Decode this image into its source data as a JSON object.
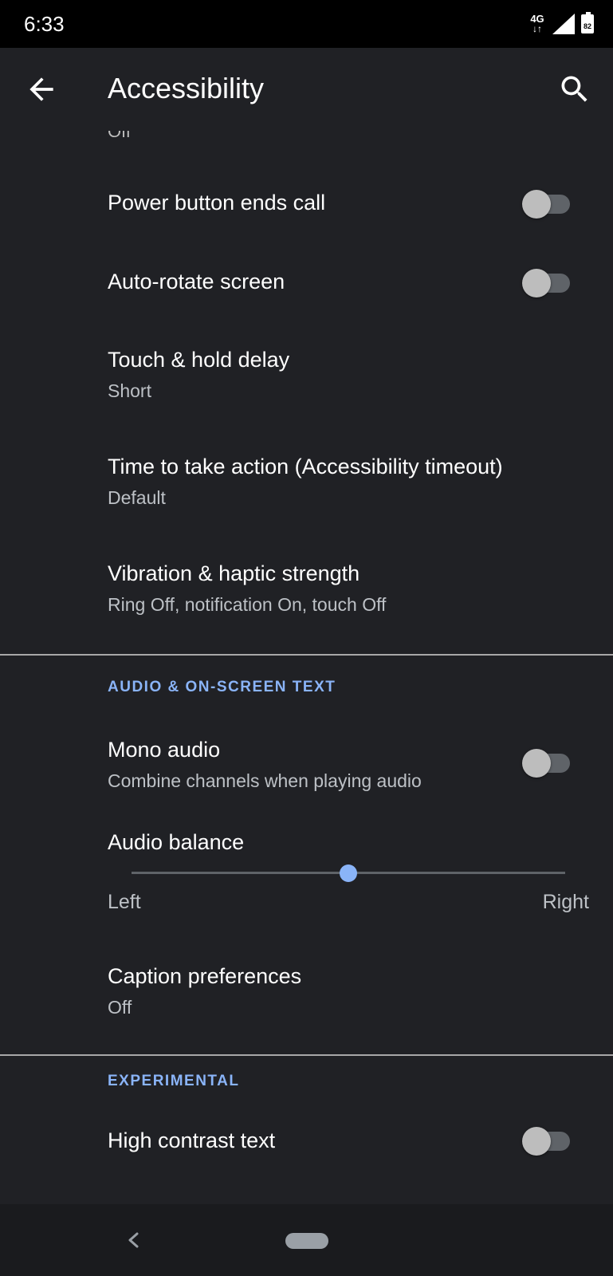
{
  "status_bar": {
    "time": "6:33",
    "network_type": "4G",
    "battery_level": "82",
    "icons": [
      "network-4g-icon",
      "signal-icon",
      "battery-icon"
    ]
  },
  "app_bar": {
    "title": "Accessibility",
    "back_icon": "arrow-back-icon",
    "search_icon": "search-icon"
  },
  "partial_top_summary": "Off",
  "items": [
    {
      "title": "Power button ends call",
      "toggle": false
    },
    {
      "title": "Auto-rotate screen",
      "toggle": false
    },
    {
      "title": "Touch & hold delay",
      "summary": "Short"
    },
    {
      "title": "Time to take action (Accessibility timeout)",
      "summary": "Default"
    },
    {
      "title": "Vibration & haptic strength",
      "summary": "Ring Off, notification On, touch Off"
    }
  ],
  "sections": {
    "audio": {
      "header": "AUDIO & ON-SCREEN TEXT",
      "mono_audio": {
        "title": "Mono audio",
        "summary": "Combine channels when playing audio",
        "toggle": false
      },
      "audio_balance": {
        "title": "Audio balance",
        "left_label": "Left",
        "right_label": "Right",
        "value": 0.5
      },
      "captions": {
        "title": "Caption preferences",
        "summary": "Off"
      }
    },
    "experimental": {
      "header": "EXPERIMENTAL",
      "high_contrast": {
        "title": "High contrast text",
        "toggle": false
      }
    }
  },
  "nav_bar": {
    "back_icon": "nav-back-icon",
    "home_icon": "home-pill-icon"
  },
  "colors": {
    "background": "#202125",
    "accent": "#8ab4f8",
    "toggle_off_thumb": "#bdbdbd",
    "toggle_off_track": "#5f6368"
  }
}
